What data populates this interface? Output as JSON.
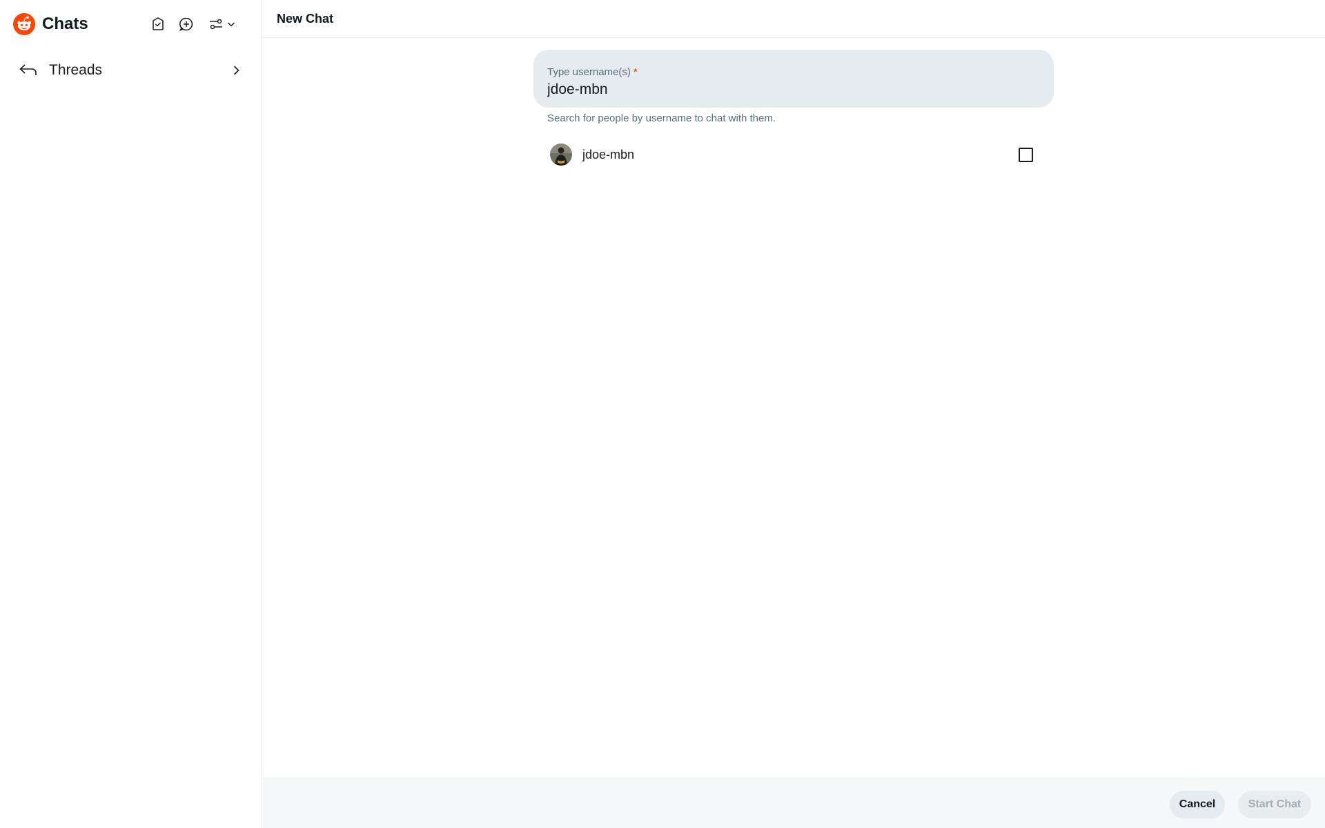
{
  "sidebar": {
    "title": "Chats",
    "icons": {
      "logo": "reddit-logo",
      "mark_read": "checkmark-inbox-icon",
      "new_chat": "new-chat-plus-bubble-icon",
      "filter": "filter-sliders-icon",
      "dropdown": "chevron-down-icon"
    },
    "items": [
      {
        "label": "Threads",
        "icon": "reply-arrow-icon",
        "trailing_icon": "chevron-right-icon"
      }
    ]
  },
  "main": {
    "title": "New Chat",
    "username_field": {
      "label": "Type username(s)",
      "required_marker": "*",
      "value": "jdoe-mbn",
      "helper": "Search for people by username to chat with them."
    },
    "results": [
      {
        "username": "jdoe-mbn",
        "checked": false
      }
    ],
    "footer": {
      "cancel_label": "Cancel",
      "start_label": "Start Chat"
    }
  },
  "colors": {
    "brand": "#ff4500",
    "field_bg": "#e5ebee",
    "required": "#d93a00",
    "footer_bg": "#f6f7f8"
  }
}
